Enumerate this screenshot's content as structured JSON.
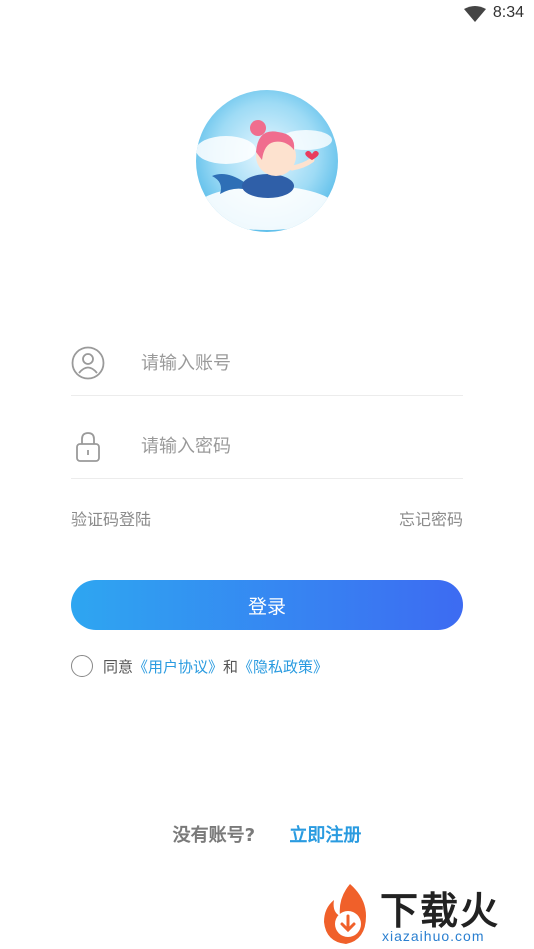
{
  "status_bar": {
    "time": "8:34",
    "wifi_icon": "wifi-icon"
  },
  "avatar": {
    "icon": "mermaid-avatar-image"
  },
  "form": {
    "username_placeholder": "请输入账号",
    "username_icon": "user-icon",
    "password_placeholder": "请输入密码",
    "password_icon": "lock-icon"
  },
  "links": {
    "sms_login": "验证码登陆",
    "forgot_password": "忘记密码"
  },
  "login_button": "登录",
  "agreement": {
    "prefix": "同意",
    "user_agreement": "《用户协议》",
    "and": "和",
    "privacy_policy": "《隐私政策》"
  },
  "register": {
    "question": "没有账号?",
    "link": "立即注册"
  },
  "watermark": {
    "title": "下载火",
    "url": "xiazaihuo.com"
  },
  "colors": {
    "accent": "#2a9be0",
    "gradient_start": "#2ea6f1",
    "gradient_end": "#3d6bf2"
  }
}
